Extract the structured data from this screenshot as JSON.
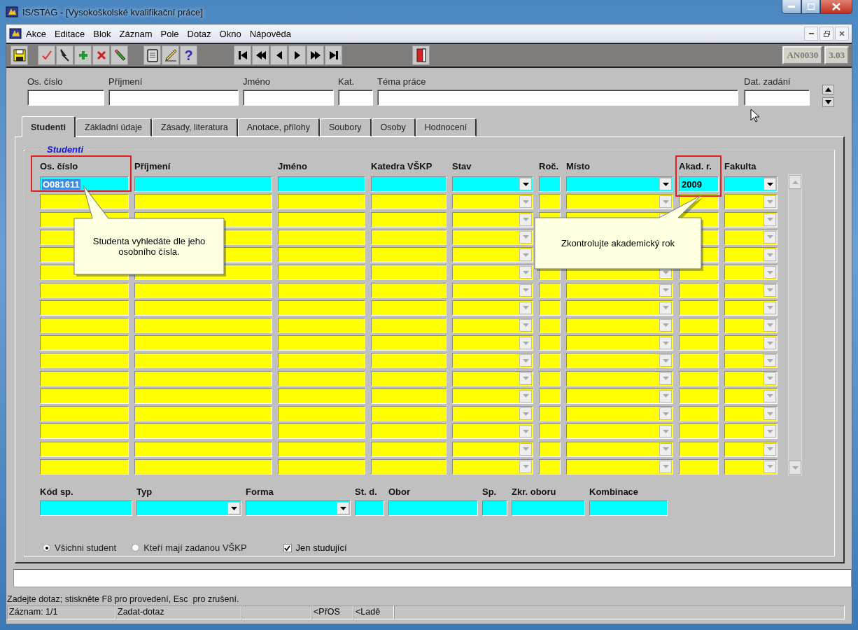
{
  "window": {
    "title": "IS/STAG - [Vysokoškolské kvalifikační práce]"
  },
  "menu": [
    "Akce",
    "Editace",
    "Blok",
    "Záznam",
    "Pole",
    "Dotaz",
    "Okno",
    "Nápověda"
  ],
  "toolbar": {
    "help_label": "?",
    "form_code": "AN0030",
    "version": "3.03"
  },
  "query_fields": [
    {
      "label": "Os. číslo"
    },
    {
      "label": "Příjmení"
    },
    {
      "label": "Jméno"
    },
    {
      "label": "Kat."
    },
    {
      "label": "Téma práce"
    },
    {
      "label": "Dat. zadání"
    }
  ],
  "tabs": [
    {
      "label": "Studenti",
      "selected": true
    },
    {
      "label": "Základní údaje",
      "selected": false
    },
    {
      "label": "Zásady, literatura",
      "selected": false
    },
    {
      "label": "Anotace, přílohy",
      "selected": false
    },
    {
      "label": "Soubory",
      "selected": false
    },
    {
      "label": "Osoby",
      "selected": false
    },
    {
      "label": "Hodnocení",
      "selected": false
    }
  ],
  "group_title": "Studenti",
  "grid": {
    "columns": [
      {
        "label": "Os. číslo",
        "kind": "text",
        "current_value": "O081611",
        "value_highlighted": true
      },
      {
        "label": "Příjmení",
        "kind": "text"
      },
      {
        "label": "Jméno",
        "kind": "text"
      },
      {
        "label": "Katedra VŠKP",
        "kind": "text"
      },
      {
        "label": "Stav",
        "kind": "dropdown"
      },
      {
        "label": "Roč.",
        "kind": "text"
      },
      {
        "label": "Místo",
        "kind": "dropdown"
      },
      {
        "label": "Akad. r.",
        "kind": "text",
        "current_value": "2009",
        "value_highlighted": false
      },
      {
        "label": "Fakulta",
        "kind": "dropdown"
      }
    ],
    "rows": [
      {
        "current": true
      },
      {
        "current": false
      },
      {
        "current": false
      },
      {
        "current": false
      },
      {
        "current": false
      },
      {
        "current": false
      },
      {
        "current": false
      },
      {
        "current": false
      },
      {
        "current": false
      },
      {
        "current": false
      },
      {
        "current": false
      },
      {
        "current": false
      },
      {
        "current": false
      },
      {
        "current": false
      },
      {
        "current": false
      },
      {
        "current": false
      },
      {
        "current": false
      }
    ]
  },
  "callouts": [
    {
      "text": "Studenta vyhledáte dle jeho osobního čísla."
    },
    {
      "text": "Zkontrolujte akademický rok"
    }
  ],
  "study_fields": [
    {
      "label": "Kód sp.",
      "kind": "text"
    },
    {
      "label": "Typ",
      "kind": "dropdown"
    },
    {
      "label": "Forma",
      "kind": "dropdown"
    },
    {
      "label": "St. d.",
      "kind": "text"
    },
    {
      "label": "Obor",
      "kind": "text"
    },
    {
      "label": "Sp.",
      "kind": "text"
    },
    {
      "label": "Zkr. oboru",
      "kind": "text"
    },
    {
      "label": "Kombinace",
      "kind": "text"
    }
  ],
  "filters": {
    "radios": [
      {
        "label": "Všichni student",
        "selected": true
      },
      {
        "label": "Kteří mají zadanou VŠKP",
        "selected": false
      }
    ],
    "checkbox": {
      "label": "Jen studující",
      "checked": true
    }
  },
  "message": "Zadejte dotaz; stiskněte F8 pro provedení, Esc  pro zrušení.",
  "status_bar": [
    "Záznam: 1/1",
    "Zadat-dotaz",
    "<PřOS",
    "<Ladě"
  ]
}
